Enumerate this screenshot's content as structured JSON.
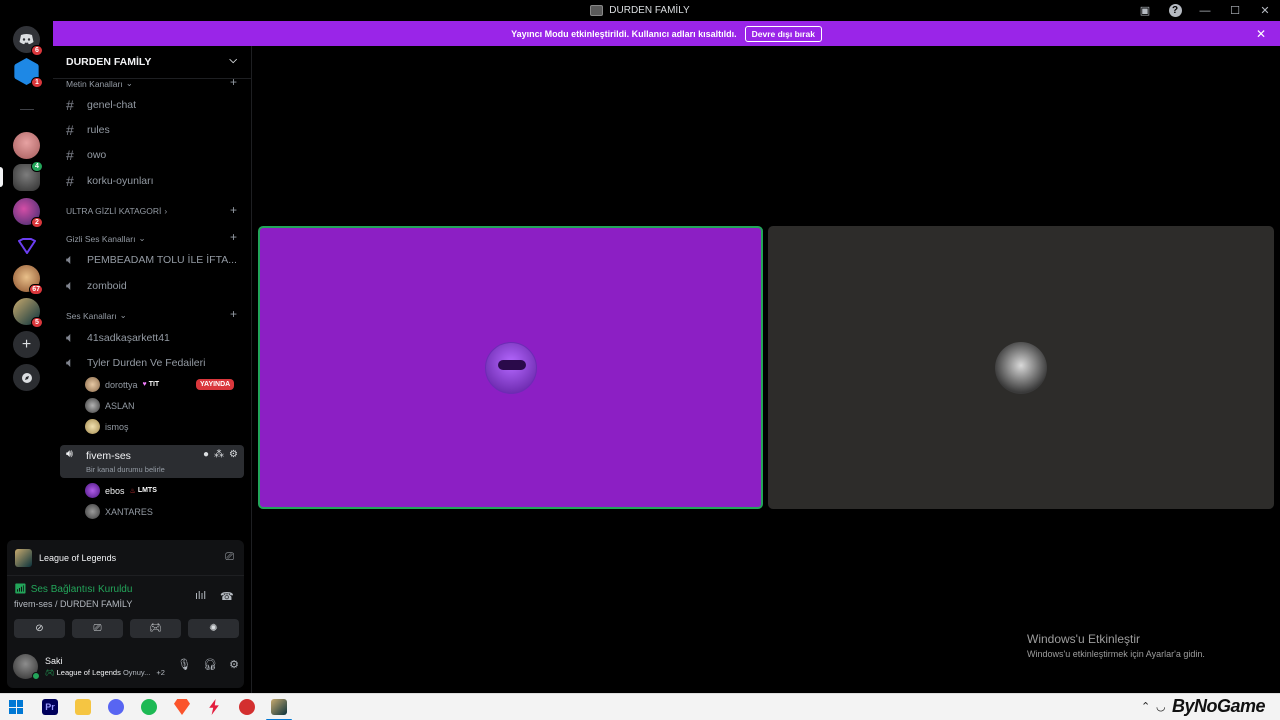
{
  "window": {
    "title": "DURDEN FAMİLY"
  },
  "banner": {
    "message": "Yayıncı Modu etkinleştirildi. Kullanıcı adları kısaltıldı.",
    "disable_label": "Devre dışı bırak"
  },
  "servers": [
    {
      "name": "discord-home",
      "badge": "6"
    },
    {
      "name": "server-1",
      "badge": "1"
    },
    {
      "name": "server-2",
      "badge": ""
    },
    {
      "name": "server-3",
      "badge": "4"
    },
    {
      "name": "server-4",
      "badge": "2"
    },
    {
      "name": "server-5",
      "badge": ""
    },
    {
      "name": "server-6",
      "badge": "67"
    },
    {
      "name": "server-7",
      "badge": "5"
    }
  ],
  "guild": {
    "name": "DURDEN FAMİLY",
    "categories": {
      "text": "Metin Kanalları",
      "secret": "ULTRA GİZLİ KATAGORİ",
      "hidden_voice": "Gizli Ses Kanalları",
      "voice": "Ses Kanalları"
    },
    "text_channels": [
      "genel-chat",
      "rules",
      "owo",
      "korku-oyunları"
    ],
    "hidden_voice_channels": [
      "PEMBEADAM TOLU İLE İFTA...",
      "zomboid"
    ],
    "voice_channels": [
      "41sadkaşarkett41",
      "Tyler Durden Ve Fedaileri"
    ],
    "tyler_members": [
      {
        "name": "dorottya",
        "tag": "TIT",
        "live": "YAYINDA"
      },
      {
        "name": "ASLAN"
      },
      {
        "name": "ismoş"
      }
    ],
    "active_channel": {
      "name": "fivem-ses",
      "subtitle": "Bir kanal durumu belirle"
    },
    "fivem_members": [
      {
        "name": "ebos",
        "tag": "LMTS"
      },
      {
        "name": "XANTARES"
      }
    ]
  },
  "panel": {
    "activity": "League of Legends",
    "voice_status": "Ses Bağlantısı Kuruldu",
    "voice_location": "fivem-ses / DURDEN FAMİLY",
    "user": {
      "name": "Saki",
      "status_game": "League of Legends",
      "status_suffix": "Oynuy...",
      "status_extra": "+2"
    }
  },
  "activation": {
    "title": "Windows'u Etkinleştir",
    "subtitle": "Windows'u etkinleştirmek için Ayarlar'a gidin."
  },
  "taskbar": {
    "brand": "ByNoGame"
  },
  "colors": {
    "banner": "#9a25e8",
    "tile_active": "#8c1fc4",
    "speaking_border": "#23a55a",
    "live_badge": "#da373c"
  }
}
